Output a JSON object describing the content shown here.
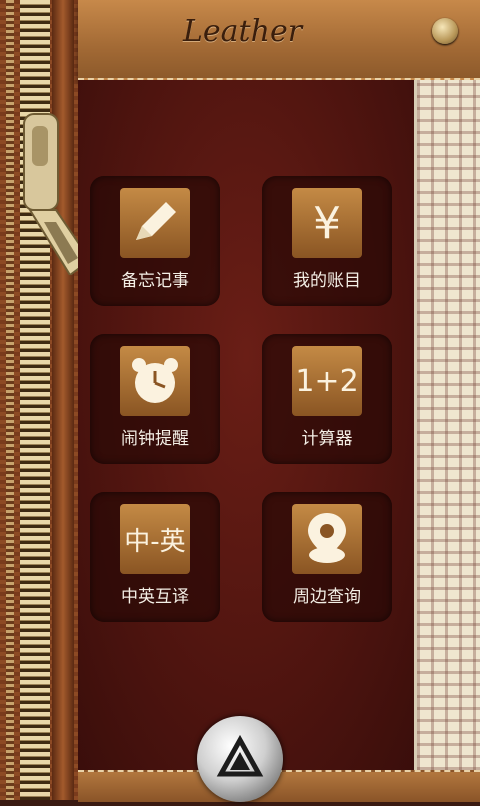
{
  "header": {
    "title": "Leather"
  },
  "tiles": [
    {
      "label": "备忘记事",
      "icon": "pencil-icon"
    },
    {
      "label": "我的账目",
      "icon": "yen-icon",
      "glyph": "¥"
    },
    {
      "label": "闹钟提醒",
      "icon": "alarm-clock-icon"
    },
    {
      "label": "计算器",
      "icon": "calculator-icon",
      "glyph": "1+2"
    },
    {
      "label": "中英互译",
      "icon": "translate-icon",
      "glyph": "中-英"
    },
    {
      "label": "周边查询",
      "icon": "location-pin-icon"
    }
  ],
  "colors": {
    "accent": "#a36a35",
    "leather": "#4e140f",
    "tile_icon": "#c48a45"
  }
}
